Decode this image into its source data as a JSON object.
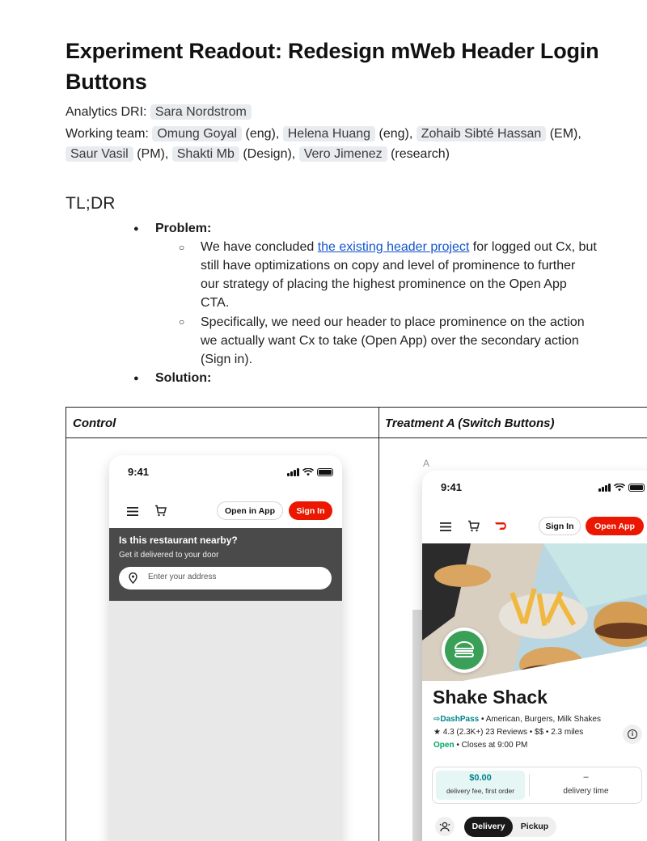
{
  "doc": {
    "title": "Experiment Readout: Redesign mWeb Header Login Buttons",
    "analytics_label": "Analytics DRI:",
    "analytics_dri": "Sara Nordstrom",
    "team_label": "Working team:",
    "team": [
      {
        "name": "Omung Goyal",
        "role": "(eng),"
      },
      {
        "name": "Helena Huang",
        "role": "(eng),"
      },
      {
        "name": "Zohaib Sibté Hassan",
        "role": "(EM),"
      },
      {
        "name": "Saur Vasil",
        "role": "(PM),"
      },
      {
        "name": "Shakti Mb",
        "role": "(Design),"
      },
      {
        "name": "Vero Jimenez",
        "role": "(research)"
      }
    ],
    "tldr_heading": "TL;DR",
    "problem_label": "Problem:",
    "problem_1_pre": "We have concluded ",
    "problem_1_link": "the existing header project",
    "problem_1_post": " for logged out Cx, but",
    "problem_1_line2": "still have optimizations on copy and level of prominence to further",
    "problem_1_line3": "our strategy of placing the highest prominence on the Open App",
    "problem_1_line4": "CTA.",
    "problem_2_line1": "Specifically, we need our header to place prominence on the action",
    "problem_2_line2": "we actually want Cx to take (Open App) over the secondary action",
    "problem_2_line3": "(Sign in).",
    "solution_label": "Solution:"
  },
  "table": {
    "col1_header": "Control",
    "col2_header": "Treatment A (Switch Buttons)"
  },
  "control_phone": {
    "time": "9:41",
    "open_in_app": "Open in App",
    "sign_in": "Sign In",
    "banner_title": "Is this restaurant nearby?",
    "banner_sub": "Get it delivered to your door",
    "address_placeholder": "Enter your address"
  },
  "treatment_phone": {
    "variant_label": "A",
    "time": "9:41",
    "sign_in": "Sign In",
    "open_app": "Open App",
    "store_name": "Shake Shack",
    "dashpass": "DashPass",
    "cuisines": "• American, Burgers, Milk Shakes",
    "rating_line": "★ 4.3 (2.3K+) 23 Reviews • $$ • 2.3 miles",
    "open_label": "Open",
    "closes": "• Closes at 9:00 PM",
    "fee_value": "$0.00",
    "fee_label": "delivery fee, first order",
    "time_value": "–",
    "time_label": "delivery time",
    "delivery_tab": "Delivery",
    "pickup_tab": "Pickup"
  },
  "colors": {
    "brand_red": "#eb1700",
    "banner_dark": "#4a4a4a",
    "link_blue": "#1155cc",
    "open_green": "#00a665",
    "dashpass_teal": "#00838a"
  }
}
